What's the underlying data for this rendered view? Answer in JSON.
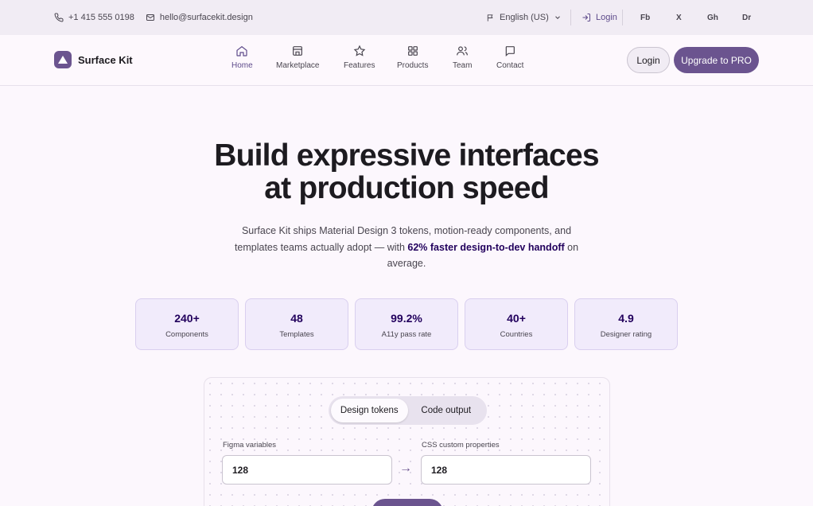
{
  "topbar": {
    "phone": "+1 415 555 0198",
    "email": "hello@surfacekit.design",
    "language": "English (US)",
    "login": "Login",
    "socials": [
      "Fb",
      "X",
      "Gh",
      "Dr"
    ]
  },
  "brand": {
    "name": "Surface Kit"
  },
  "nav": {
    "items": [
      {
        "label": "Home",
        "icon": "home-icon",
        "active": true
      },
      {
        "label": "Marketplace",
        "icon": "store-icon"
      },
      {
        "label": "Features",
        "icon": "star-icon"
      },
      {
        "label": "Products",
        "icon": "grid-icon"
      },
      {
        "label": "Team",
        "icon": "users-icon"
      },
      {
        "label": "Contact",
        "icon": "chat-icon"
      }
    ],
    "login_label": "Login",
    "upgrade_label": "Upgrade to PRO"
  },
  "hero": {
    "title_line1": "Build expressive interfaces",
    "title_line2": "at production speed",
    "sub_part1": "Surface Kit ships Material Design 3 tokens, motion-ready components, and templates teams actually adopt — with ",
    "sub_highlight": "62% faster design-to-dev handoff",
    "sub_part2": " on average."
  },
  "stats": [
    {
      "value": "240+",
      "label": "Components"
    },
    {
      "value": "48",
      "label": "Templates"
    },
    {
      "value": "99.2%",
      "label": "A11y pass rate"
    },
    {
      "value": "40+",
      "label": "Countries"
    },
    {
      "value": "4.9",
      "label": "Designer rating"
    }
  ],
  "demo": {
    "tabs": [
      "Design tokens",
      "Code output"
    ],
    "left_label": "Figma variables",
    "left_value": "128",
    "right_label": "CSS custom properties",
    "right_value": "128",
    "arrow": "→"
  },
  "colors": {
    "accent": "#6b548f",
    "accent_dark": "#22005d",
    "surface": "#fcf7fd",
    "topbar": "#f1ecf4"
  }
}
